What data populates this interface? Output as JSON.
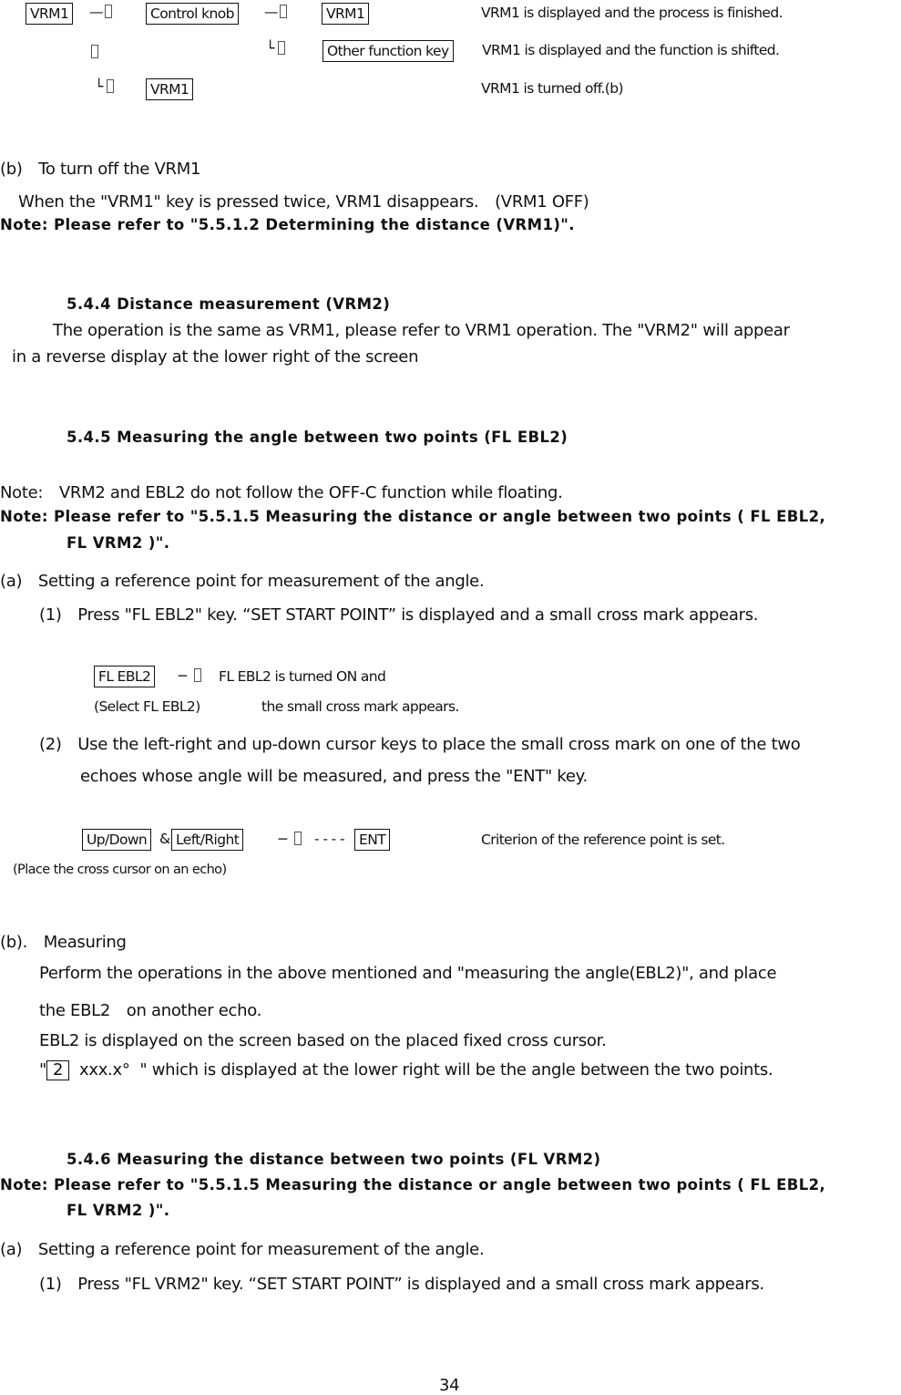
{
  "diagram_vrm1": {
    "key_vrm1_start": "VRM1",
    "key_control_knob": "Control knob",
    "key_vrm1_end": "VRM1",
    "key_other_function": "Other function key",
    "key_vrm1_off": "VRM1",
    "arrow_dash": "—",
    "branch_mark": "└",
    "result_1": "VRM1 is displayed and the process is finished.",
    "result_2": "VRM1 is displayed and the function is shifted.",
    "result_3": "VRM1 is turned off.(b)"
  },
  "section_b_off": {
    "heading": "(b)　To turn off the VRM1",
    "text": "When the \"VRM1\" key is pressed twice, VRM1 disappears.　(VRM1 OFF)",
    "note": "Note: Please refer to \"5.5.1.2 Determining the distance (VRM1)\"."
  },
  "section_544": {
    "title": "5.4.4 Distance measurement (VRM2)",
    "line1": "The operation is the same as VRM1, please refer to VRM1 operation. The \"VRM2\" will appear",
    "line2": "in a reverse display at the lower right of the screen"
  },
  "section_545": {
    "title": "5.4.5 Measuring the angle between two points (FL EBL2)",
    "note1": "Note:　VRM2 and EBL2 do not follow the OFF-C function while floating.",
    "note2_line1": "Note: Please refer to \"5.5.1.5 Measuring the distance or angle between two points ( FL EBL2,",
    "note2_line2": "FL VRM2 )\".",
    "step_a": "(a)　Setting a reference point for measurement of the angle.",
    "step_1": "(1)　Press \"FL EBL2\" key. “SET START POINT” is displayed and a small cross mark appears.",
    "diagram1": {
      "key": "FL EBL2",
      "arrow": "−",
      "result_line1": "FL EBL2 is turned ON and",
      "caption": "(Select FL EBL2)",
      "result_line2": "the small cross mark appears."
    },
    "step_2_line1": "(2)　Use the left-right and up-down cursor keys to place the small cross mark on one of the two",
    "step_2_line2": "echoes whose angle will be measured, and press the \"ENT\" key.",
    "diagram2": {
      "key_updown": "Up/Down",
      "amp": "&",
      "key_leftright": "Left/Right",
      "arrow": "−",
      "dashes": "- - - -",
      "key_ent": "ENT",
      "result": "Criterion of the reference point is set.",
      "caption": "(Place the cross cursor on an echo)"
    },
    "step_b": "(b).　Measuring",
    "measure_line1": "Perform the operations in the above mentioned and \"measuring the angle(EBL2)\", and place",
    "measure_line2": "the EBL2　on another echo.",
    "measure_line3": "EBL2 is displayed on the screen based on the placed fixed cross cursor.",
    "measure_line4_quote_open": "\"",
    "measure_line4_key": "2",
    "measure_line4_rest": "xxx.x°  \" which is displayed at the lower right will be the angle between the two points."
  },
  "section_546": {
    "title": "5.4.6 Measuring the distance between two points (FL VRM2)",
    "note_line1": "Note: Please refer to \"5.5.1.5 Measuring the distance or angle between two points ( FL EBL2,",
    "note_line2": "FL VRM2 )\".",
    "step_a": "(a)　Setting a reference point for measurement of the angle.",
    "step_1": "(1)　Press \"FL VRM2\" key. “SET START POINT” is displayed and a small cross mark appears."
  },
  "page_number": "34"
}
